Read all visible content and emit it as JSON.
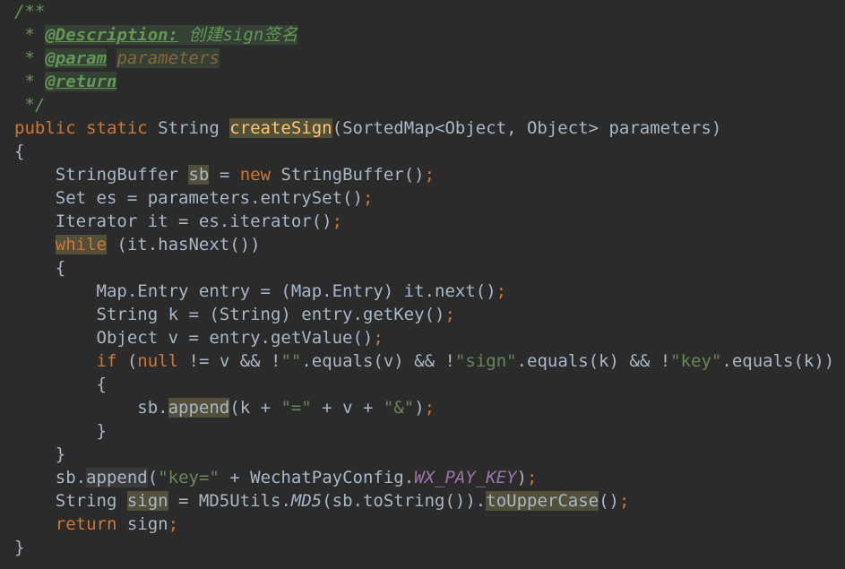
{
  "code_lines": [
    {
      "indent": "",
      "tokens": [
        {
          "text": "/**",
          "cls": "t-comment"
        }
      ]
    },
    {
      "indent": " ",
      "tokens": [
        {
          "text": "* ",
          "cls": "t-comment"
        },
        {
          "text": "@Description:",
          "cls": "t-tag hl-green"
        },
        {
          "text": " 创建sign签名",
          "cls": "t-comment hl-green"
        }
      ]
    },
    {
      "indent": " ",
      "tokens": [
        {
          "text": "* ",
          "cls": "t-comment"
        },
        {
          "text": "@param",
          "cls": "t-tag hl-green"
        },
        {
          "text": " ",
          "cls": "t-comment"
        },
        {
          "text": "parameters",
          "cls": "t-tagvalue hl-green"
        }
      ]
    },
    {
      "indent": " ",
      "tokens": [
        {
          "text": "* ",
          "cls": "t-comment"
        },
        {
          "text": "@return",
          "cls": "t-tag hl-green"
        }
      ]
    },
    {
      "indent": " ",
      "tokens": [
        {
          "text": "*/",
          "cls": "t-comment"
        }
      ]
    },
    {
      "indent": "",
      "tokens": [
        {
          "text": "public ",
          "cls": "t-keyword"
        },
        {
          "text": "static ",
          "cls": "t-keyword"
        },
        {
          "text": "String ",
          "cls": "t-plain"
        },
        {
          "text": "createSign",
          "cls": "t-method hl-olive"
        },
        {
          "text": "(SortedMap<Object, Object> parameters)",
          "cls": "t-plain"
        }
      ]
    },
    {
      "indent": "",
      "tokens": [
        {
          "text": "{",
          "cls": "t-plain"
        }
      ]
    },
    {
      "indent": "    ",
      "tokens": [
        {
          "text": "StringBuffer ",
          "cls": "t-plain"
        },
        {
          "text": "sb",
          "cls": "t-plain hl-olive"
        },
        {
          "text": " = ",
          "cls": "t-plain"
        },
        {
          "text": "new ",
          "cls": "t-keyword"
        },
        {
          "text": "StringBuffer()",
          "cls": "t-plain"
        },
        {
          "text": ";",
          "cls": "t-keyword"
        }
      ]
    },
    {
      "indent": "    ",
      "tokens": [
        {
          "text": "Set es = parameters.entrySet()",
          "cls": "t-plain"
        },
        {
          "text": ";",
          "cls": "t-keyword"
        }
      ]
    },
    {
      "indent": "    ",
      "tokens": [
        {
          "text": "Iterator it = es.iterator()",
          "cls": "t-plain"
        },
        {
          "text": ";",
          "cls": "t-keyword"
        }
      ]
    },
    {
      "indent": "    ",
      "tokens": [
        {
          "text": "while",
          "cls": "t-keyword hl-olive"
        },
        {
          "text": " (it.hasNext())",
          "cls": "t-plain"
        }
      ]
    },
    {
      "indent": "    ",
      "tokens": [
        {
          "text": "{",
          "cls": "t-plain"
        }
      ]
    },
    {
      "indent": "        ",
      "tokens": [
        {
          "text": "Map.Entry entry = (Map.Entry) it.next()",
          "cls": "t-plain"
        },
        {
          "text": ";",
          "cls": "t-keyword"
        }
      ]
    },
    {
      "indent": "        ",
      "tokens": [
        {
          "text": "String k = (String) entry.getKey()",
          "cls": "t-plain"
        },
        {
          "text": ";",
          "cls": "t-keyword"
        }
      ]
    },
    {
      "indent": "        ",
      "tokens": [
        {
          "text": "Object v = entry.getValue()",
          "cls": "t-plain"
        },
        {
          "text": ";",
          "cls": "t-keyword"
        }
      ]
    },
    {
      "indent": "        ",
      "tokens": [
        {
          "text": "if ",
          "cls": "t-keyword"
        },
        {
          "text": "(",
          "cls": "t-plain"
        },
        {
          "text": "null ",
          "cls": "t-keyword"
        },
        {
          "text": "!= v && !",
          "cls": "t-plain"
        },
        {
          "text": "\"\"",
          "cls": "t-string"
        },
        {
          "text": ".equals(v) && !",
          "cls": "t-plain"
        },
        {
          "text": "\"sign\"",
          "cls": "t-string"
        },
        {
          "text": ".equals(k) && !",
          "cls": "t-plain"
        },
        {
          "text": "\"key\"",
          "cls": "t-string"
        },
        {
          "text": ".equals(k))",
          "cls": "t-plain"
        }
      ]
    },
    {
      "indent": "        ",
      "tokens": [
        {
          "text": "{",
          "cls": "t-plain"
        }
      ]
    },
    {
      "indent": "            ",
      "tokens": [
        {
          "text": "sb.",
          "cls": "t-plain"
        },
        {
          "text": "append",
          "cls": "t-plain hl-olive"
        },
        {
          "text": "(k + ",
          "cls": "t-plain"
        },
        {
          "text": "\"=\"",
          "cls": "t-string"
        },
        {
          "text": " + v + ",
          "cls": "t-plain"
        },
        {
          "text": "\"&\"",
          "cls": "t-string"
        },
        {
          "text": ")",
          "cls": "t-plain"
        },
        {
          "text": ";",
          "cls": "t-keyword"
        }
      ]
    },
    {
      "indent": "        ",
      "tokens": [
        {
          "text": "}",
          "cls": "t-plain"
        }
      ]
    },
    {
      "indent": "    ",
      "tokens": [
        {
          "text": "}",
          "cls": "t-plain"
        }
      ]
    },
    {
      "indent": "    ",
      "tokens": [
        {
          "text": "sb.",
          "cls": "t-plain"
        },
        {
          "text": "append",
          "cls": "t-plain hl-gray"
        },
        {
          "text": "(",
          "cls": "t-plain"
        },
        {
          "text": "\"key=\"",
          "cls": "t-string"
        },
        {
          "text": " + WechatPayConfig.",
          "cls": "t-plain"
        },
        {
          "text": "WX_PAY_KEY",
          "cls": "t-static"
        },
        {
          "text": ")",
          "cls": "t-plain"
        },
        {
          "text": ";",
          "cls": "t-keyword"
        }
      ]
    },
    {
      "indent": "    ",
      "tokens": [
        {
          "text": "String ",
          "cls": "t-plain"
        },
        {
          "text": "sign",
          "cls": "t-plain hl-olive"
        },
        {
          "text": " = MD5Utils.",
          "cls": "t-plain"
        },
        {
          "text": "MD5",
          "cls": "t-static-call"
        },
        {
          "text": "(sb.toString()).",
          "cls": "t-plain"
        },
        {
          "text": "toUpperCase",
          "cls": "t-plain hl-olive"
        },
        {
          "text": "()",
          "cls": "t-plain"
        },
        {
          "text": ";",
          "cls": "t-keyword"
        }
      ]
    },
    {
      "indent": "    ",
      "tokens": [
        {
          "text": "return ",
          "cls": "t-keyword"
        },
        {
          "text": "sign",
          "cls": "t-plain"
        },
        {
          "text": ";",
          "cls": "t-keyword"
        }
      ]
    },
    {
      "indent": "",
      "tokens": [
        {
          "text": "}",
          "cls": "t-plain"
        }
      ]
    }
  ]
}
